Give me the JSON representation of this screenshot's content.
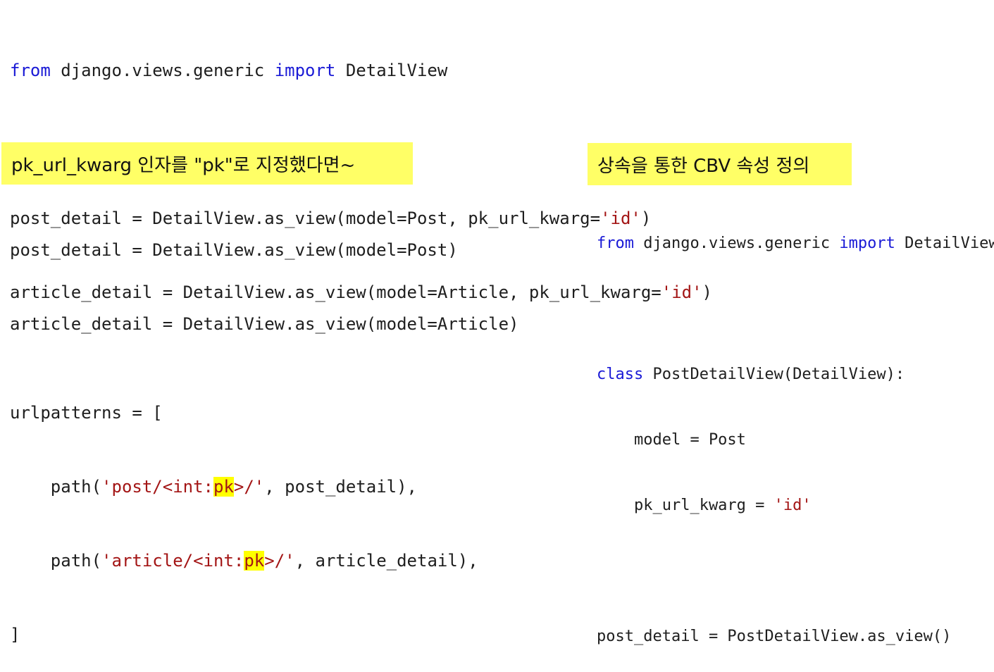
{
  "block1": {
    "import_from": "from",
    "import_module": " django.views.generic ",
    "import_kw": "import",
    "import_name": " DetailView",
    "line_post_a": "post_detail = DetailView.as_view(model=Post, pk_url_kwarg=",
    "line_post_str": "'id'",
    "line_post_b": ")",
    "line_article_a": "article_detail = DetailView.as_view(model=Article, pk_url_kwarg=",
    "line_article_str": "'id'",
    "line_article_b": ")"
  },
  "note_left": "pk_url_kwarg 인자를 \"pk\"로 지정했다면~",
  "note_right": "상속을 통한 CBV 속성 정의",
  "block2": {
    "line_post": "post_detail = DetailView.as_view(model=Post)",
    "line_article": "article_detail = DetailView.as_view(model=Article)"
  },
  "block3": {
    "open": "urlpatterns = [",
    "path1_a": "    path(",
    "path1_str_a": "'post/<int:",
    "path1_pk": "pk",
    "path1_str_b": ">/'",
    "path1_b": ", post_detail),",
    "path2_a": "    path(",
    "path2_str_a": "'article/<int:",
    "path2_pk": "pk",
    "path2_str_b": ">/'",
    "path2_b": ", article_detail),",
    "close": "]"
  },
  "block4": {
    "import_from": "from",
    "import_module": " django.views.generic ",
    "import_kw": "import",
    "import_name": " DetailView",
    "class_kw": "class",
    "class_rest": " PostDetailView(DetailView):",
    "model_line": "    model = Post",
    "kwarg_a": "    pk_url_kwarg = ",
    "kwarg_str": "'id'",
    "as_view_line": "post_detail = PostDetailView.as_view()"
  },
  "colors": {
    "keyword": "#1a1ad6",
    "string": "#a31515",
    "highlight": "#ffff00",
    "note_bg": "#ffff66"
  }
}
